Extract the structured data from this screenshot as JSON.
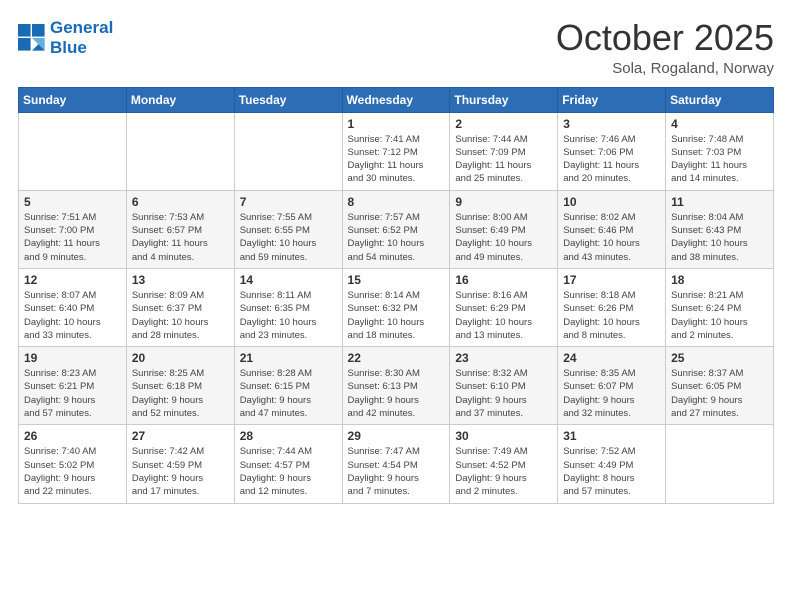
{
  "logo": {
    "line1": "General",
    "line2": "Blue"
  },
  "title": "October 2025",
  "subtitle": "Sola, Rogaland, Norway",
  "weekdays": [
    "Sunday",
    "Monday",
    "Tuesday",
    "Wednesday",
    "Thursday",
    "Friday",
    "Saturday"
  ],
  "weeks": [
    [
      {
        "day": "",
        "info": ""
      },
      {
        "day": "",
        "info": ""
      },
      {
        "day": "",
        "info": ""
      },
      {
        "day": "1",
        "info": "Sunrise: 7:41 AM\nSunset: 7:12 PM\nDaylight: 11 hours\nand 30 minutes."
      },
      {
        "day": "2",
        "info": "Sunrise: 7:44 AM\nSunset: 7:09 PM\nDaylight: 11 hours\nand 25 minutes."
      },
      {
        "day": "3",
        "info": "Sunrise: 7:46 AM\nSunset: 7:06 PM\nDaylight: 11 hours\nand 20 minutes."
      },
      {
        "day": "4",
        "info": "Sunrise: 7:48 AM\nSunset: 7:03 PM\nDaylight: 11 hours\nand 14 minutes."
      }
    ],
    [
      {
        "day": "5",
        "info": "Sunrise: 7:51 AM\nSunset: 7:00 PM\nDaylight: 11 hours\nand 9 minutes."
      },
      {
        "day": "6",
        "info": "Sunrise: 7:53 AM\nSunset: 6:57 PM\nDaylight: 11 hours\nand 4 minutes."
      },
      {
        "day": "7",
        "info": "Sunrise: 7:55 AM\nSunset: 6:55 PM\nDaylight: 10 hours\nand 59 minutes."
      },
      {
        "day": "8",
        "info": "Sunrise: 7:57 AM\nSunset: 6:52 PM\nDaylight: 10 hours\nand 54 minutes."
      },
      {
        "day": "9",
        "info": "Sunrise: 8:00 AM\nSunset: 6:49 PM\nDaylight: 10 hours\nand 49 minutes."
      },
      {
        "day": "10",
        "info": "Sunrise: 8:02 AM\nSunset: 6:46 PM\nDaylight: 10 hours\nand 43 minutes."
      },
      {
        "day": "11",
        "info": "Sunrise: 8:04 AM\nSunset: 6:43 PM\nDaylight: 10 hours\nand 38 minutes."
      }
    ],
    [
      {
        "day": "12",
        "info": "Sunrise: 8:07 AM\nSunset: 6:40 PM\nDaylight: 10 hours\nand 33 minutes."
      },
      {
        "day": "13",
        "info": "Sunrise: 8:09 AM\nSunset: 6:37 PM\nDaylight: 10 hours\nand 28 minutes."
      },
      {
        "day": "14",
        "info": "Sunrise: 8:11 AM\nSunset: 6:35 PM\nDaylight: 10 hours\nand 23 minutes."
      },
      {
        "day": "15",
        "info": "Sunrise: 8:14 AM\nSunset: 6:32 PM\nDaylight: 10 hours\nand 18 minutes."
      },
      {
        "day": "16",
        "info": "Sunrise: 8:16 AM\nSunset: 6:29 PM\nDaylight: 10 hours\nand 13 minutes."
      },
      {
        "day": "17",
        "info": "Sunrise: 8:18 AM\nSunset: 6:26 PM\nDaylight: 10 hours\nand 8 minutes."
      },
      {
        "day": "18",
        "info": "Sunrise: 8:21 AM\nSunset: 6:24 PM\nDaylight: 10 hours\nand 2 minutes."
      }
    ],
    [
      {
        "day": "19",
        "info": "Sunrise: 8:23 AM\nSunset: 6:21 PM\nDaylight: 9 hours\nand 57 minutes."
      },
      {
        "day": "20",
        "info": "Sunrise: 8:25 AM\nSunset: 6:18 PM\nDaylight: 9 hours\nand 52 minutes."
      },
      {
        "day": "21",
        "info": "Sunrise: 8:28 AM\nSunset: 6:15 PM\nDaylight: 9 hours\nand 47 minutes."
      },
      {
        "day": "22",
        "info": "Sunrise: 8:30 AM\nSunset: 6:13 PM\nDaylight: 9 hours\nand 42 minutes."
      },
      {
        "day": "23",
        "info": "Sunrise: 8:32 AM\nSunset: 6:10 PM\nDaylight: 9 hours\nand 37 minutes."
      },
      {
        "day": "24",
        "info": "Sunrise: 8:35 AM\nSunset: 6:07 PM\nDaylight: 9 hours\nand 32 minutes."
      },
      {
        "day": "25",
        "info": "Sunrise: 8:37 AM\nSunset: 6:05 PM\nDaylight: 9 hours\nand 27 minutes."
      }
    ],
    [
      {
        "day": "26",
        "info": "Sunrise: 7:40 AM\nSunset: 5:02 PM\nDaylight: 9 hours\nand 22 minutes."
      },
      {
        "day": "27",
        "info": "Sunrise: 7:42 AM\nSunset: 4:59 PM\nDaylight: 9 hours\nand 17 minutes."
      },
      {
        "day": "28",
        "info": "Sunrise: 7:44 AM\nSunset: 4:57 PM\nDaylight: 9 hours\nand 12 minutes."
      },
      {
        "day": "29",
        "info": "Sunrise: 7:47 AM\nSunset: 4:54 PM\nDaylight: 9 hours\nand 7 minutes."
      },
      {
        "day": "30",
        "info": "Sunrise: 7:49 AM\nSunset: 4:52 PM\nDaylight: 9 hours\nand 2 minutes."
      },
      {
        "day": "31",
        "info": "Sunrise: 7:52 AM\nSunset: 4:49 PM\nDaylight: 8 hours\nand 57 minutes."
      },
      {
        "day": "",
        "info": ""
      }
    ]
  ]
}
